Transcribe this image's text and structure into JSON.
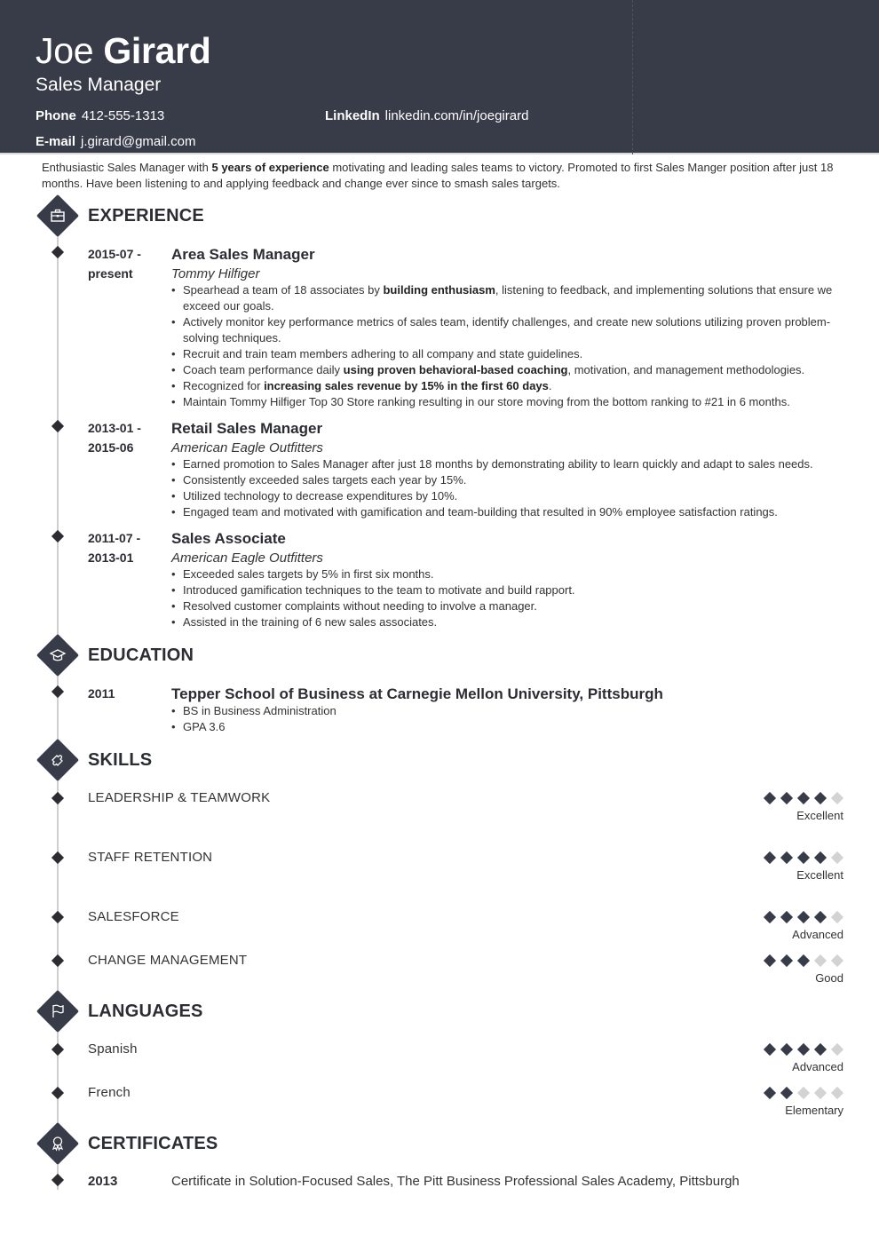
{
  "header": {
    "first_name": "Joe",
    "last_name": "Girard",
    "title": "Sales Manager",
    "phone_label": "Phone",
    "phone": "412-555-1313",
    "linkedin_label": "LinkedIn",
    "linkedin": "linkedin.com/in/joegirard",
    "email_label": "E-mail",
    "email": "j.girard@gmail.com"
  },
  "summary": {
    "before": "Enthusiastic Sales Manager with ",
    "bold": "5 years of experience",
    "after": " motivating and leading sales teams to victory. Promoted to first Sales Manger position after just 18 months. Have been listening to and applying feedback and change ever since to smash sales targets."
  },
  "sections": {
    "experience": "EXPERIENCE",
    "education": "EDUCATION",
    "skills": "SKILLS",
    "languages": "LANGUAGES",
    "certificates": "CERTIFICATES"
  },
  "icons": {
    "experience": "briefcase-icon",
    "education": "graduation-cap-icon",
    "skills": "puzzle-icon",
    "languages": "flag-icon",
    "certificates": "award-ribbon-icon"
  },
  "experience": [
    {
      "date_start": "2015-07 -",
      "date_end": "present",
      "role": "Area Sales Manager",
      "company": "Tommy Hilfiger",
      "bullets": [
        {
          "pre": "Spearhead a team of 18 associates by ",
          "bold": "building enthusiasm",
          "post": ", listening to feedback, and implementing solutions that ensure we exceed our goals."
        },
        {
          "pre": "Actively monitor key performance metrics of sales team, identify challenges, and create new solutions utilizing proven problem-solving techniques.",
          "bold": "",
          "post": ""
        },
        {
          "pre": "Recruit and train team members adhering to all company and state guidelines.",
          "bold": "",
          "post": ""
        },
        {
          "pre": "Coach team performance daily ",
          "bold": "using proven behavioral-based coaching",
          "post": ", motivation, and management methodologies."
        },
        {
          "pre": "Recognized for ",
          "bold": "increasing sales revenue by 15% in the first 60 days",
          "post": "."
        },
        {
          "pre": "Maintain Tommy Hilfiger Top 30 Store ranking resulting in our store moving from the bottom ranking to #21 in 6 months.",
          "bold": "",
          "post": ""
        }
      ]
    },
    {
      "date_start": "2013-01 -",
      "date_end": "2015-06",
      "role": "Retail Sales Manager",
      "company": "American Eagle Outfitters",
      "bullets": [
        {
          "pre": "Earned promotion to Sales Manager after just 18 months by demonstrating ability to learn quickly and adapt to sales needs.",
          "bold": "",
          "post": ""
        },
        {
          "pre": "Consistently exceeded sales targets each year by 15%.",
          "bold": "",
          "post": ""
        },
        {
          "pre": "Utilized technology to decrease expenditures by 10%.",
          "bold": "",
          "post": ""
        },
        {
          "pre": "Engaged team and motivated with gamification and team-building that resulted in 90% employee satisfaction ratings.",
          "bold": "",
          "post": ""
        }
      ]
    },
    {
      "date_start": "2011-07 -",
      "date_end": "2013-01",
      "role": "Sales Associate",
      "company": "American Eagle Outfitters",
      "bullets": [
        {
          "pre": "Exceeded sales targets by 5% in first six months.",
          "bold": "",
          "post": ""
        },
        {
          "pre": "Introduced gamification techniques to the team to motivate and build rapport.",
          "bold": "",
          "post": ""
        },
        {
          "pre": "Resolved customer complaints without needing to involve a manager.",
          "bold": "",
          "post": ""
        },
        {
          "pre": "Assisted in the training of 6 new sales associates.",
          "bold": "",
          "post": ""
        }
      ]
    }
  ],
  "education": [
    {
      "year": "2011",
      "school": "Tepper School of Business at Carnegie Mellon University, Pittsburgh",
      "bullets": [
        "BS in Business Administration",
        "GPA 3.6"
      ]
    }
  ],
  "skills": [
    {
      "name": "LEADERSHIP & TEAMWORK",
      "rating": 4,
      "max": 5,
      "level": "Excellent"
    },
    {
      "name": "STAFF RETENTION",
      "rating": 4,
      "max": 5,
      "level": "Excellent"
    },
    {
      "name": "SALESFORCE",
      "rating": 4,
      "max": 5,
      "level": "Advanced"
    },
    {
      "name": "CHANGE MANAGEMENT",
      "rating": 3,
      "max": 5,
      "level": "Good"
    }
  ],
  "languages": [
    {
      "name": "Spanish",
      "rating": 4,
      "max": 5,
      "level": "Advanced"
    },
    {
      "name": "French",
      "rating": 2,
      "max": 5,
      "level": "Elementary"
    }
  ],
  "certificates": [
    {
      "year": "2013",
      "text": "Certificate in Solution-Focused Sales, The Pitt Business Professional Sales Academy, Pittsburgh"
    }
  ]
}
